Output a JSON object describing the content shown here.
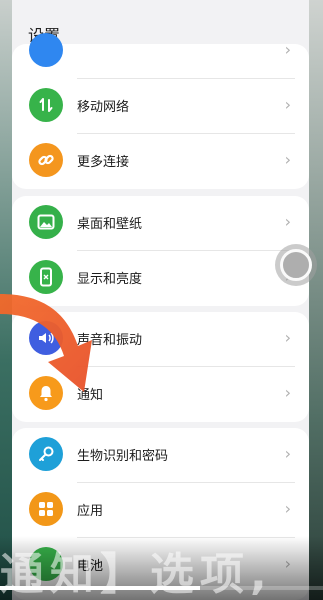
{
  "header": {
    "title": "设置"
  },
  "items": [
    {
      "label": "",
      "icon": "partial-blue-icon",
      "color": "#2f87f0"
    },
    {
      "label": "移动网络",
      "icon": "mobile-data-icon",
      "color": "#37b34a"
    },
    {
      "label": "更多连接",
      "icon": "link-icon",
      "color": "#f4961e"
    },
    {
      "label": "桌面和壁纸",
      "icon": "image-icon",
      "color": "#35b04a"
    },
    {
      "label": "显示和亮度",
      "icon": "phone-display-icon",
      "color": "#37b34a"
    },
    {
      "label": "声音和振动",
      "icon": "speaker-icon",
      "color": "#3f5ee0"
    },
    {
      "label": "通知",
      "icon": "bell-icon",
      "color": "#f79a1b"
    },
    {
      "label": "生物识别和密码",
      "icon": "key-icon",
      "color": "#1ea0d8"
    },
    {
      "label": "应用",
      "icon": "apps-icon",
      "color": "#f29718"
    },
    {
      "label": "电池",
      "icon": "battery-icon",
      "color": "#37b34a"
    }
  ],
  "chevron": "›",
  "overlay": {
    "caption": "通知】选项,",
    "progress": 0.62
  }
}
